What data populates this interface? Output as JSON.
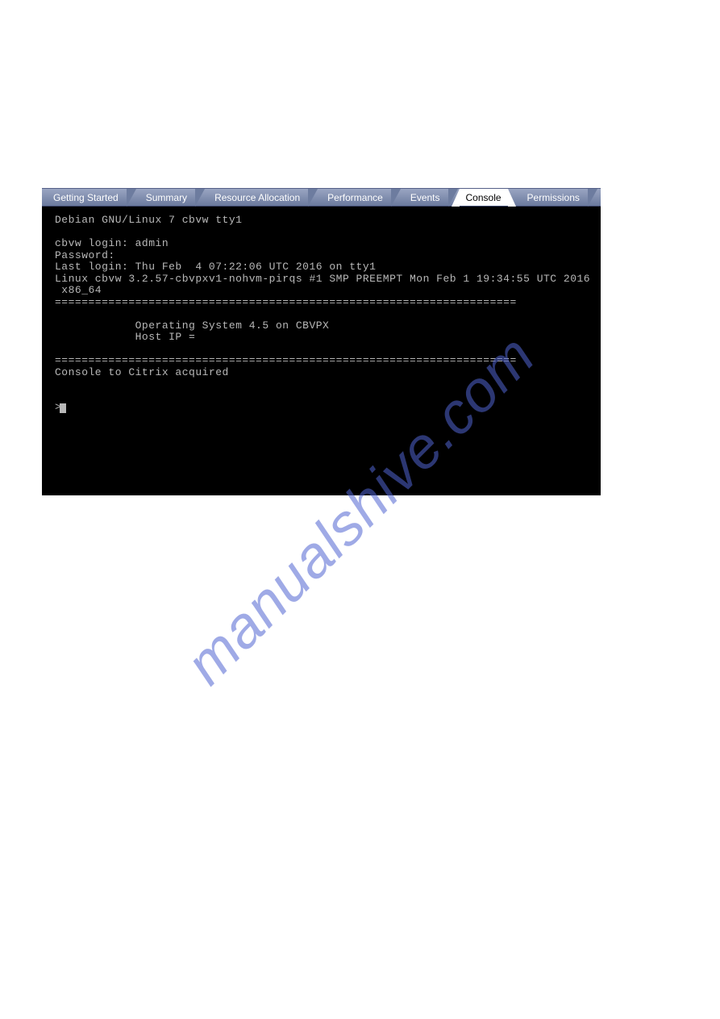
{
  "tabs": [
    {
      "label": "Getting Started",
      "active": false
    },
    {
      "label": "Summary",
      "active": false
    },
    {
      "label": "Resource Allocation",
      "active": false
    },
    {
      "label": "Performance",
      "active": false
    },
    {
      "label": "Events",
      "active": false
    },
    {
      "label": "Console",
      "active": true
    },
    {
      "label": "Permissions",
      "active": false
    }
  ],
  "console": {
    "banner": "Debian GNU/Linux 7 cbvw tty1",
    "login_prompt": "cbvw login: admin",
    "password_prompt": "Password:",
    "last_login": "Last login: Thu Feb  4 07:22:06 UTC 2016 on tty1",
    "kernel": "Linux cbvw 3.2.57-cbvpxv1-nohvm-pirqs #1 SMP PREEMPT Mon Feb 1 19:34:55 UTC 2016",
    "arch": " x86_64",
    "sep": "=====================================================================",
    "os_line": "            Operating System 4.5 on CBVPX",
    "host_line": "            Host IP =",
    "acquired": "Console to Citrix acquired",
    "prompt": ">"
  },
  "watermark": "manualshive.com"
}
